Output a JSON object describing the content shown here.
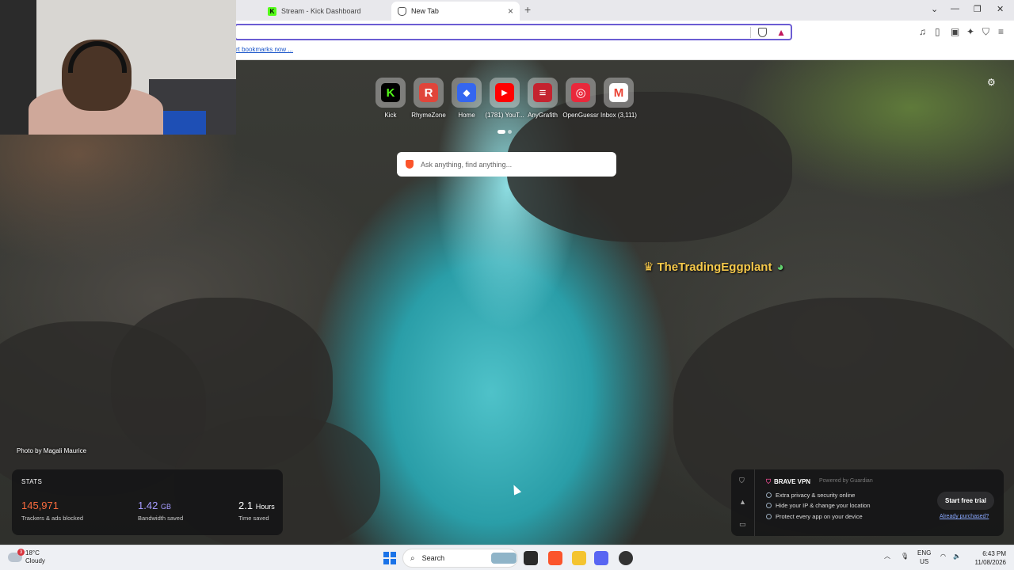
{
  "tabs": [
    {
      "label": "Stream - Kick Dashboard",
      "icon": "kick-icon"
    },
    {
      "label": "New Tab",
      "icon": "brave-icon",
      "active": true
    }
  ],
  "bookmarks_bar": {
    "text": "rt bookmarks now ..."
  },
  "shortcuts": [
    {
      "label": "Kick",
      "icon": "K",
      "color": "#53fc18"
    },
    {
      "label": "RhymeZone",
      "icon": "R",
      "color": "#e0453a"
    },
    {
      "label": "Home",
      "icon": "◆",
      "color": "#3466f0"
    },
    {
      "label": "(1781) YouT...",
      "icon": "▶",
      "color": "#ff0000"
    },
    {
      "label": "AnyGrafith",
      "icon": "≡",
      "color": "#c4232f"
    },
    {
      "label": "OpenGuessr",
      "icon": "◎",
      "color": "#e9283b"
    },
    {
      "label": "Inbox (3,111)",
      "icon": "M",
      "color": "#ea4335"
    }
  ],
  "search": {
    "placeholder": "Ask anything, find anything..."
  },
  "overlay": {
    "name": "TheTradingEggplant"
  },
  "photo_credit": "Photo by Magali Maurice",
  "stats": {
    "title": "STATS",
    "trackers": {
      "value": "145,971",
      "label": "Trackers & ads blocked"
    },
    "bandwidth": {
      "value": "1.42",
      "unit": "GB",
      "label": "Bandwidth saved"
    },
    "time": {
      "value": "2.1",
      "unit": "Hours",
      "label": "Time saved"
    }
  },
  "vpn": {
    "title": "BRAVE VPN",
    "powered_by": "Powered by  Guardian",
    "features": [
      "Extra privacy & security online",
      "Hide your IP & change your location",
      "Protect every app on your device"
    ],
    "cta": "Start free trial",
    "link": "Already purchased?"
  },
  "taskbar": {
    "weather": {
      "temp": "18°C",
      "condition": "Cloudy",
      "badge": "3"
    },
    "search_label": "Search",
    "lang": {
      "code": "ENG",
      "region": "US"
    },
    "time": "6:43 PM",
    "date": "11/08/2026"
  }
}
